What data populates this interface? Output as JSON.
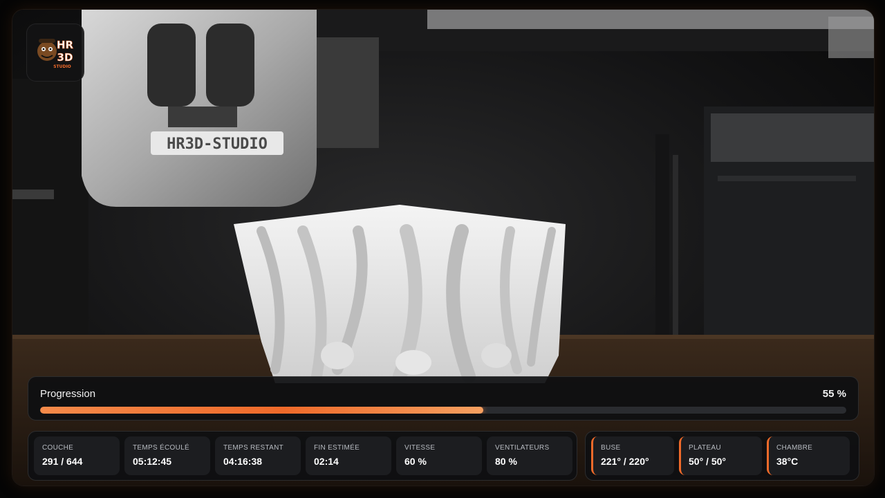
{
  "camera": {
    "nozzle_label_text": "HR3D-STUDIO"
  },
  "logo": {
    "line1": "HR",
    "line2": "3D",
    "line3": "STUDIO"
  },
  "progress": {
    "label": "Progression",
    "value_text": "55 %",
    "percent": 55
  },
  "print_stats": [
    {
      "label": "COUCHE",
      "value": "291 / 644"
    },
    {
      "label": "TEMPS ÉCOULÉ",
      "value": "05:12:45"
    },
    {
      "label": "TEMPS RESTANT",
      "value": "04:16:38"
    },
    {
      "label": "FIN ESTIMÉE",
      "value": "02:14"
    },
    {
      "label": "VITESSE",
      "value": "60 %"
    },
    {
      "label": "VENTILATEURS",
      "value": "80 %"
    }
  ],
  "temperature_stats": [
    {
      "label": "BUSE",
      "value": "221° / 220°"
    },
    {
      "label": "PLATEAU",
      "value": "50° / 50°"
    },
    {
      "label": "CHAMBRE",
      "value": "38°C"
    }
  ],
  "colors": {
    "accent": "#ef6a2a",
    "accent_light": "#f7a060",
    "panel_bg": "#0e0f11",
    "card_bg": "#1c1d20"
  }
}
